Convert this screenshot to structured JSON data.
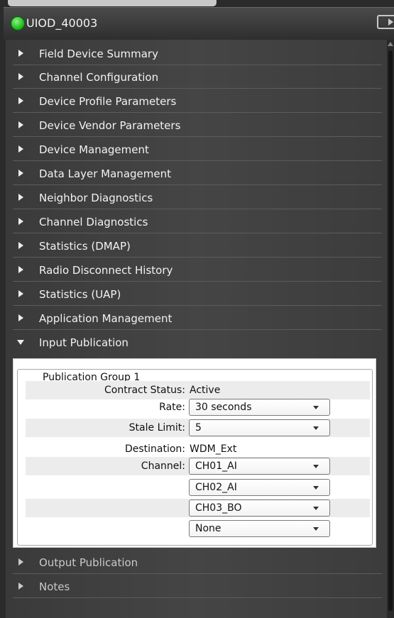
{
  "device": {
    "name": "UIOD_40003",
    "status_color": "#22c022"
  },
  "sections": [
    {
      "label": "Field Device Summary",
      "expanded": false
    },
    {
      "label": "Channel Configuration",
      "expanded": false
    },
    {
      "label": "Device Profile Parameters",
      "expanded": false
    },
    {
      "label": "Device Vendor Parameters",
      "expanded": false
    },
    {
      "label": "Device Management",
      "expanded": false
    },
    {
      "label": "Data Layer Management",
      "expanded": false
    },
    {
      "label": "Neighbor Diagnostics",
      "expanded": false
    },
    {
      "label": "Channel Diagnostics",
      "expanded": false
    },
    {
      "label": "Statistics (DMAP)",
      "expanded": false
    },
    {
      "label": "Radio Disconnect History",
      "expanded": false
    },
    {
      "label": "Statistics (UAP)",
      "expanded": false
    },
    {
      "label": "Application Management",
      "expanded": false
    },
    {
      "label": "Input Publication",
      "expanded": true
    },
    {
      "label": "Output Publication",
      "expanded": false
    },
    {
      "label": "Notes",
      "expanded": false
    }
  ],
  "publication_group": {
    "title": "Publication Group 1",
    "contract_status_label": "Contract Status:",
    "contract_status_value": "Active",
    "rate_label": "Rate:",
    "rate_value": "30 seconds",
    "stale_limit_label": "Stale Limit:",
    "stale_limit_value": "5",
    "destination_label": "Destination:",
    "destination_value": "WDM_Ext",
    "channel_label": "Channel:",
    "channels": [
      "CH01_AI",
      "CH02_AI",
      "CH03_BO",
      "None"
    ]
  }
}
